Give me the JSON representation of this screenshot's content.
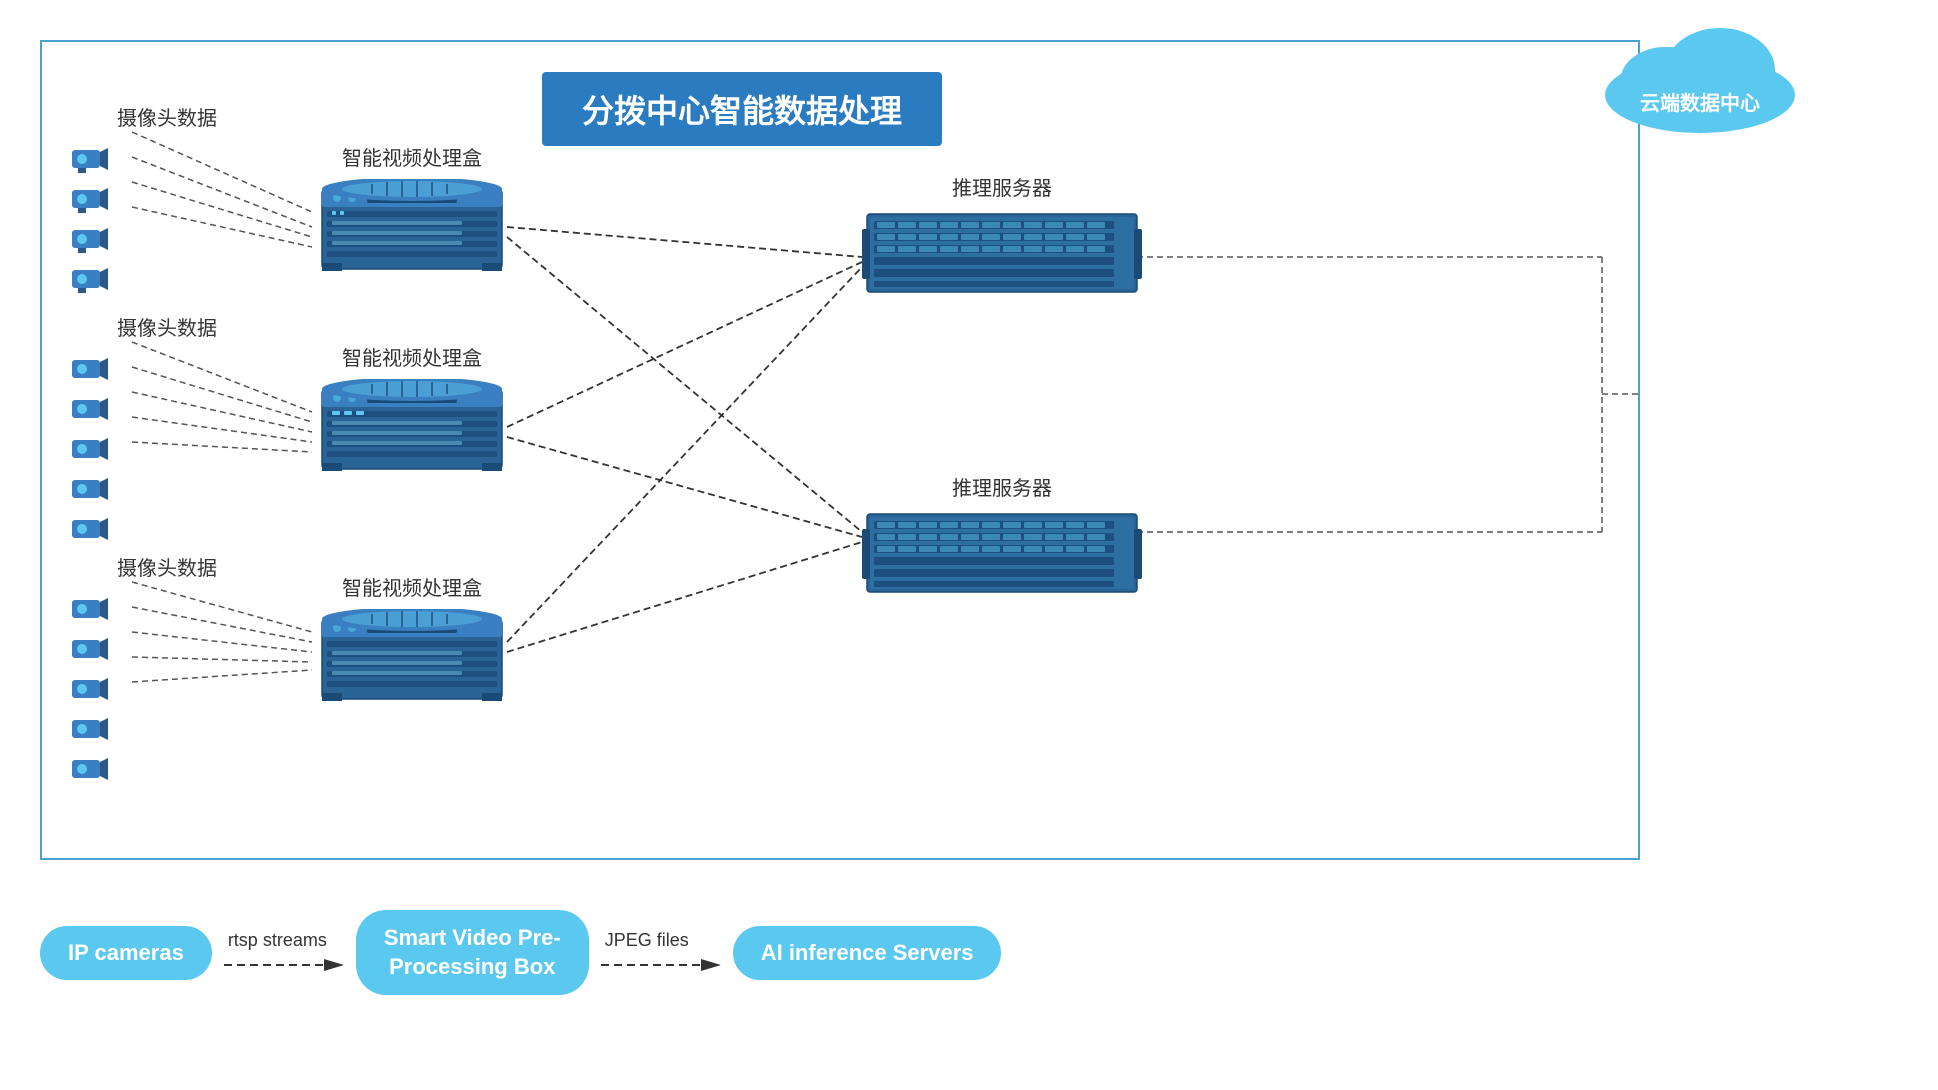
{
  "title": "分拨中心智能数据处理",
  "cloud_label": "云端数据中心",
  "camera_groups": [
    {
      "label": "摄像头数据",
      "count": 4
    },
    {
      "label": "摄像头数据",
      "count": 5
    },
    {
      "label": "摄像头数据",
      "count": 5
    }
  ],
  "vpb_labels": [
    "智能视频处理盒",
    "智能视频处理盒",
    "智能视频处理盒"
  ],
  "inference_labels": [
    "推理服务器",
    "推理服务器"
  ],
  "legend": {
    "ip_cameras": "IP cameras",
    "rtsp_streams": "rtsp streams",
    "smart_box": "Smart Video Pre-\nProcessing Box",
    "jpeg_files": "JPEG files",
    "ai_servers": "AI inference Servers"
  }
}
